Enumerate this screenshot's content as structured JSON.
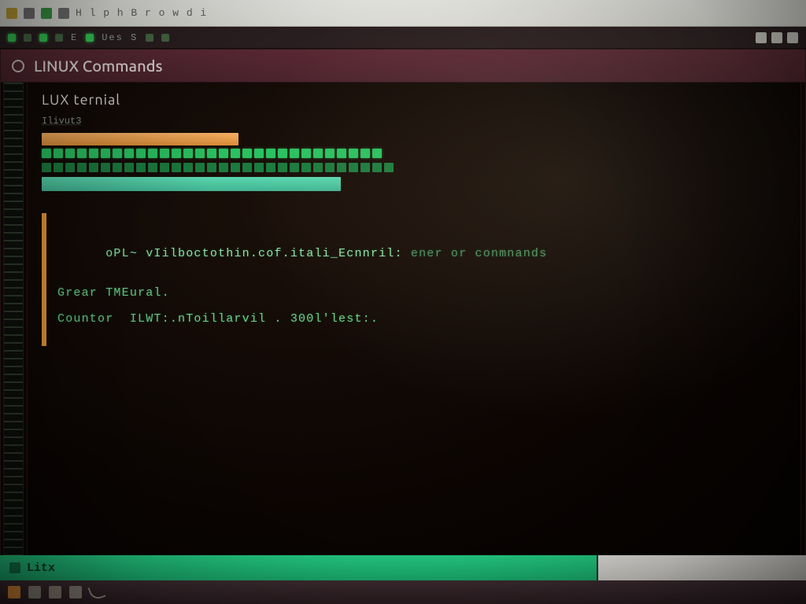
{
  "browser_bar": {
    "url_hint": "H l p h B r o w d i"
  },
  "toolbar": {
    "segment_a": "E",
    "segment_b": "Ues S"
  },
  "window": {
    "title": "LINUX  Commands"
  },
  "panel": {
    "subheader": "LUX ternial",
    "small_label": "Ilivut3"
  },
  "code": {
    "line1_a": "oPL~ vIilboctothin.cof.itali_Ecnnril:",
    "line1_b": " ener or conmnands",
    "line2": "Grear TMEural.",
    "line3": "Countor  ILWT:.nToillarvil . 300l'lest:."
  },
  "status": {
    "label": "Litx"
  }
}
